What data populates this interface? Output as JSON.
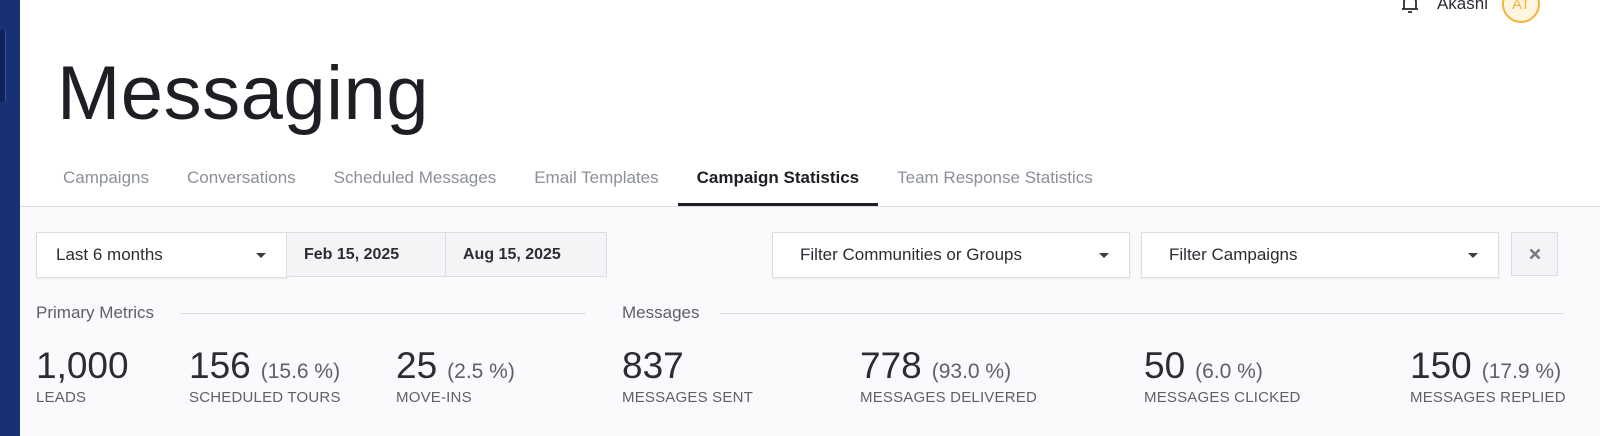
{
  "user": {
    "name": "Akashi",
    "initials": "AT"
  },
  "page": {
    "title": "Messaging"
  },
  "tabs": [
    {
      "label": "Campaigns"
    },
    {
      "label": "Conversations"
    },
    {
      "label": "Scheduled Messages"
    },
    {
      "label": "Email Templates"
    },
    {
      "label": "Campaign Statistics",
      "active": true
    },
    {
      "label": "Team Response Statistics"
    }
  ],
  "filters": {
    "range": "Last 6 months",
    "start_date": "Feb 15, 2025",
    "end_date": "Aug 15, 2025",
    "communities": "Filter Communities or Groups",
    "campaigns": "Filter Campaigns",
    "clear_icon": "close-icon"
  },
  "primary_metrics": {
    "label": "Primary Metrics",
    "items": [
      {
        "value": "1,000",
        "pct": "",
        "label": "LEADS"
      },
      {
        "value": "156",
        "pct": "(15.6 %)",
        "label": "SCHEDULED TOURS"
      },
      {
        "value": "25",
        "pct": "(2.5 %)",
        "label": "MOVE-INS"
      }
    ]
  },
  "messages": {
    "label": "Messages",
    "items": [
      {
        "value": "837",
        "pct": "",
        "label": "MESSAGES SENT"
      },
      {
        "value": "778",
        "pct": "(93.0 %)",
        "label": "MESSAGES DELIVERED"
      },
      {
        "value": "50",
        "pct": "(6.0 %)",
        "label": "MESSAGES CLICKED"
      },
      {
        "value": "150",
        "pct": "(17.9 %)",
        "label": "MESSAGES REPLIED"
      }
    ]
  },
  "colors": {
    "rail": "#183175",
    "accent_avatar": "#f3b43a",
    "text_dark": "#1e1f24",
    "text_muted": "#8b8f99"
  }
}
